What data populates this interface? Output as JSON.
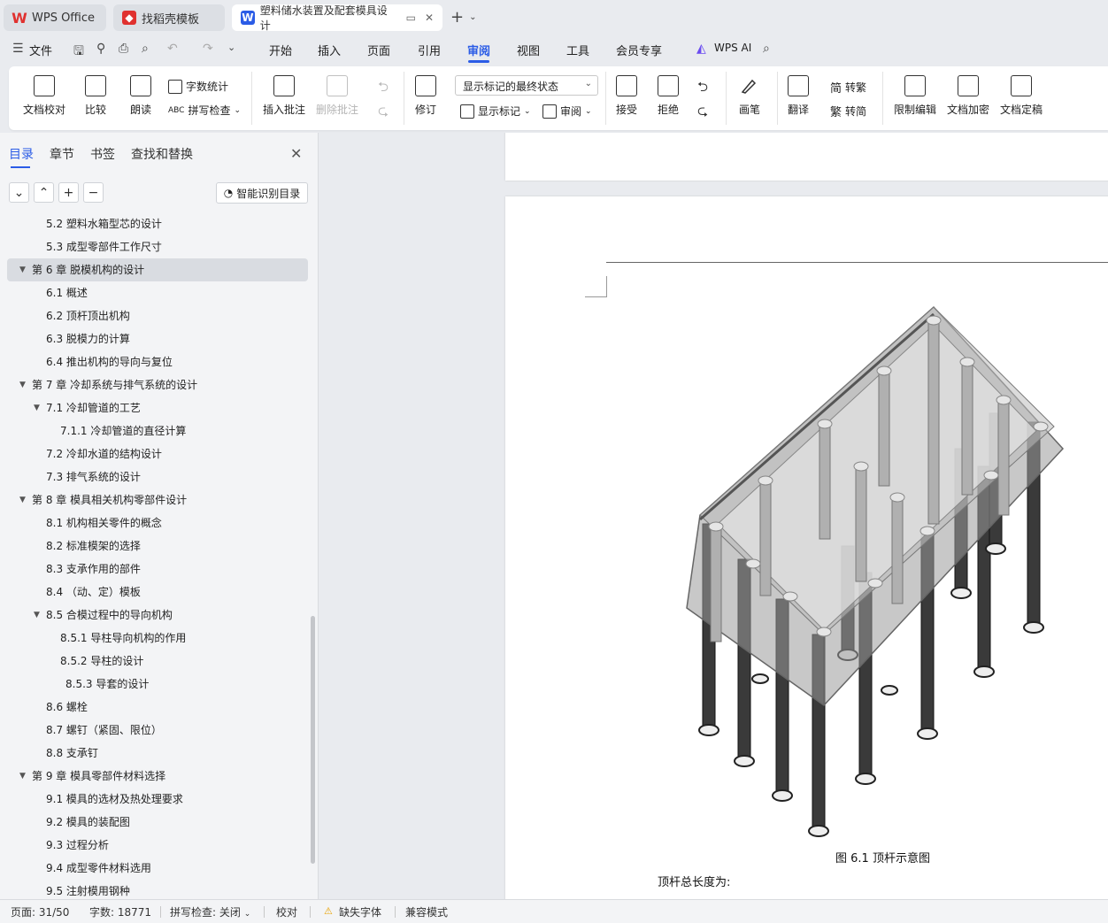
{
  "titlebar": {
    "tabs": [
      {
        "label": "WPS Office"
      },
      {
        "label": "找稻壳模板"
      },
      {
        "label": "塑料储水装置及配套模具设计"
      }
    ],
    "new_tab": "+"
  },
  "menubar": {
    "file": "文件",
    "items": [
      "开始",
      "插入",
      "页面",
      "引用",
      "审阅",
      "视图",
      "工具",
      "会员专享"
    ],
    "active": "审阅",
    "wps_ai": "WPS AI"
  },
  "ribbon": {
    "proofread": "文档校对",
    "compare": "比较",
    "read_aloud": "朗读",
    "word_count": "字数统计",
    "spell_check": "拼写检查",
    "insert_comment": "插入批注",
    "delete_comment": "删除批注",
    "revise": "修订",
    "markup_state": "显示标记的最终状态",
    "show_markup": "显示标记",
    "review": "审阅",
    "accept": "接受",
    "reject": "拒绝",
    "pen": "画笔",
    "translate": "翻译",
    "to_traditional": "转繁",
    "to_simplified": "转简",
    "restrict_edit": "限制编辑",
    "encrypt": "文档加密",
    "finalize": "文档定稿"
  },
  "navpane": {
    "tabs": [
      "目录",
      "章节",
      "书签",
      "查找和替换"
    ],
    "smart_toc": "智能识别目录",
    "toc": [
      {
        "label": "5.2 塑料水箱型芯的设计",
        "level": 2
      },
      {
        "label": "5.3 成型零部件工作尺寸",
        "level": 2
      },
      {
        "label": "第 6 章   脱模机构的设计",
        "level": 1,
        "expanded": true,
        "selected": true
      },
      {
        "label": "6.1 概述",
        "level": 2
      },
      {
        "label": "6.2 顶杆顶出机构",
        "level": 2
      },
      {
        "label": "6.3  脱模力的计算",
        "level": 2
      },
      {
        "label": "6.4 推出机构的导向与复位",
        "level": 2
      },
      {
        "label": "第 7 章  冷却系统与排气系统的设计",
        "level": 1,
        "expanded": true
      },
      {
        "label": "7.1  冷却管道的工艺",
        "level": 2,
        "expanded": true
      },
      {
        "label": "7.1.1  冷却管道的直径计算",
        "level": 3
      },
      {
        "label": "7.2  冷却水道的结构设计",
        "level": 2
      },
      {
        "label": "7.3  排气系统的设计",
        "level": 2
      },
      {
        "label": "第 8 章  模具相关机构零部件设计",
        "level": 1,
        "expanded": true
      },
      {
        "label": "8.1 机构相关零件的概念",
        "level": 2
      },
      {
        "label": "8.2 标准模架的选择",
        "level": 2
      },
      {
        "label": "8.3 支承作用的部件",
        "level": 2
      },
      {
        "label": "8.4 （动、定）模板",
        "level": 2
      },
      {
        "label": "8.5 合模过程中的导向机构",
        "level": 2,
        "expanded": true
      },
      {
        "label": "8.5.1 导柱导向机构的作用",
        "level": 3
      },
      {
        "label": "8.5.2  导柱的设计",
        "level": 3
      },
      {
        "label": "8.5.3 导套的设计",
        "level": 3,
        "indent_extra": true
      },
      {
        "label": "8.6 螺栓",
        "level": 2
      },
      {
        "label": "8.7 螺钉（紧固、限位）",
        "level": 2
      },
      {
        "label": "8.8 支承钉",
        "level": 2
      },
      {
        "label": "第 9 章  模具零部件材料选择",
        "level": 1,
        "expanded": true
      },
      {
        "label": "9.1 模具的选材及热处理要求",
        "level": 2
      },
      {
        "label": "9.2 模具的装配图",
        "level": 2
      },
      {
        "label": "9.3 过程分析",
        "level": 2
      },
      {
        "label": "9.4  成型零件材料选用",
        "level": 2
      },
      {
        "label": "9.5 注射模用钢种",
        "level": 2
      }
    ]
  },
  "document": {
    "caption": "图 6.1  顶杆示意图",
    "body_text": "顶杆总长度为:"
  },
  "statusbar": {
    "page": "页面: 31/50",
    "words": "字数: 18771",
    "spell": "拼写检查: 关闭",
    "proof": "校对",
    "missing_font": "缺失字体",
    "compat": "兼容模式"
  }
}
